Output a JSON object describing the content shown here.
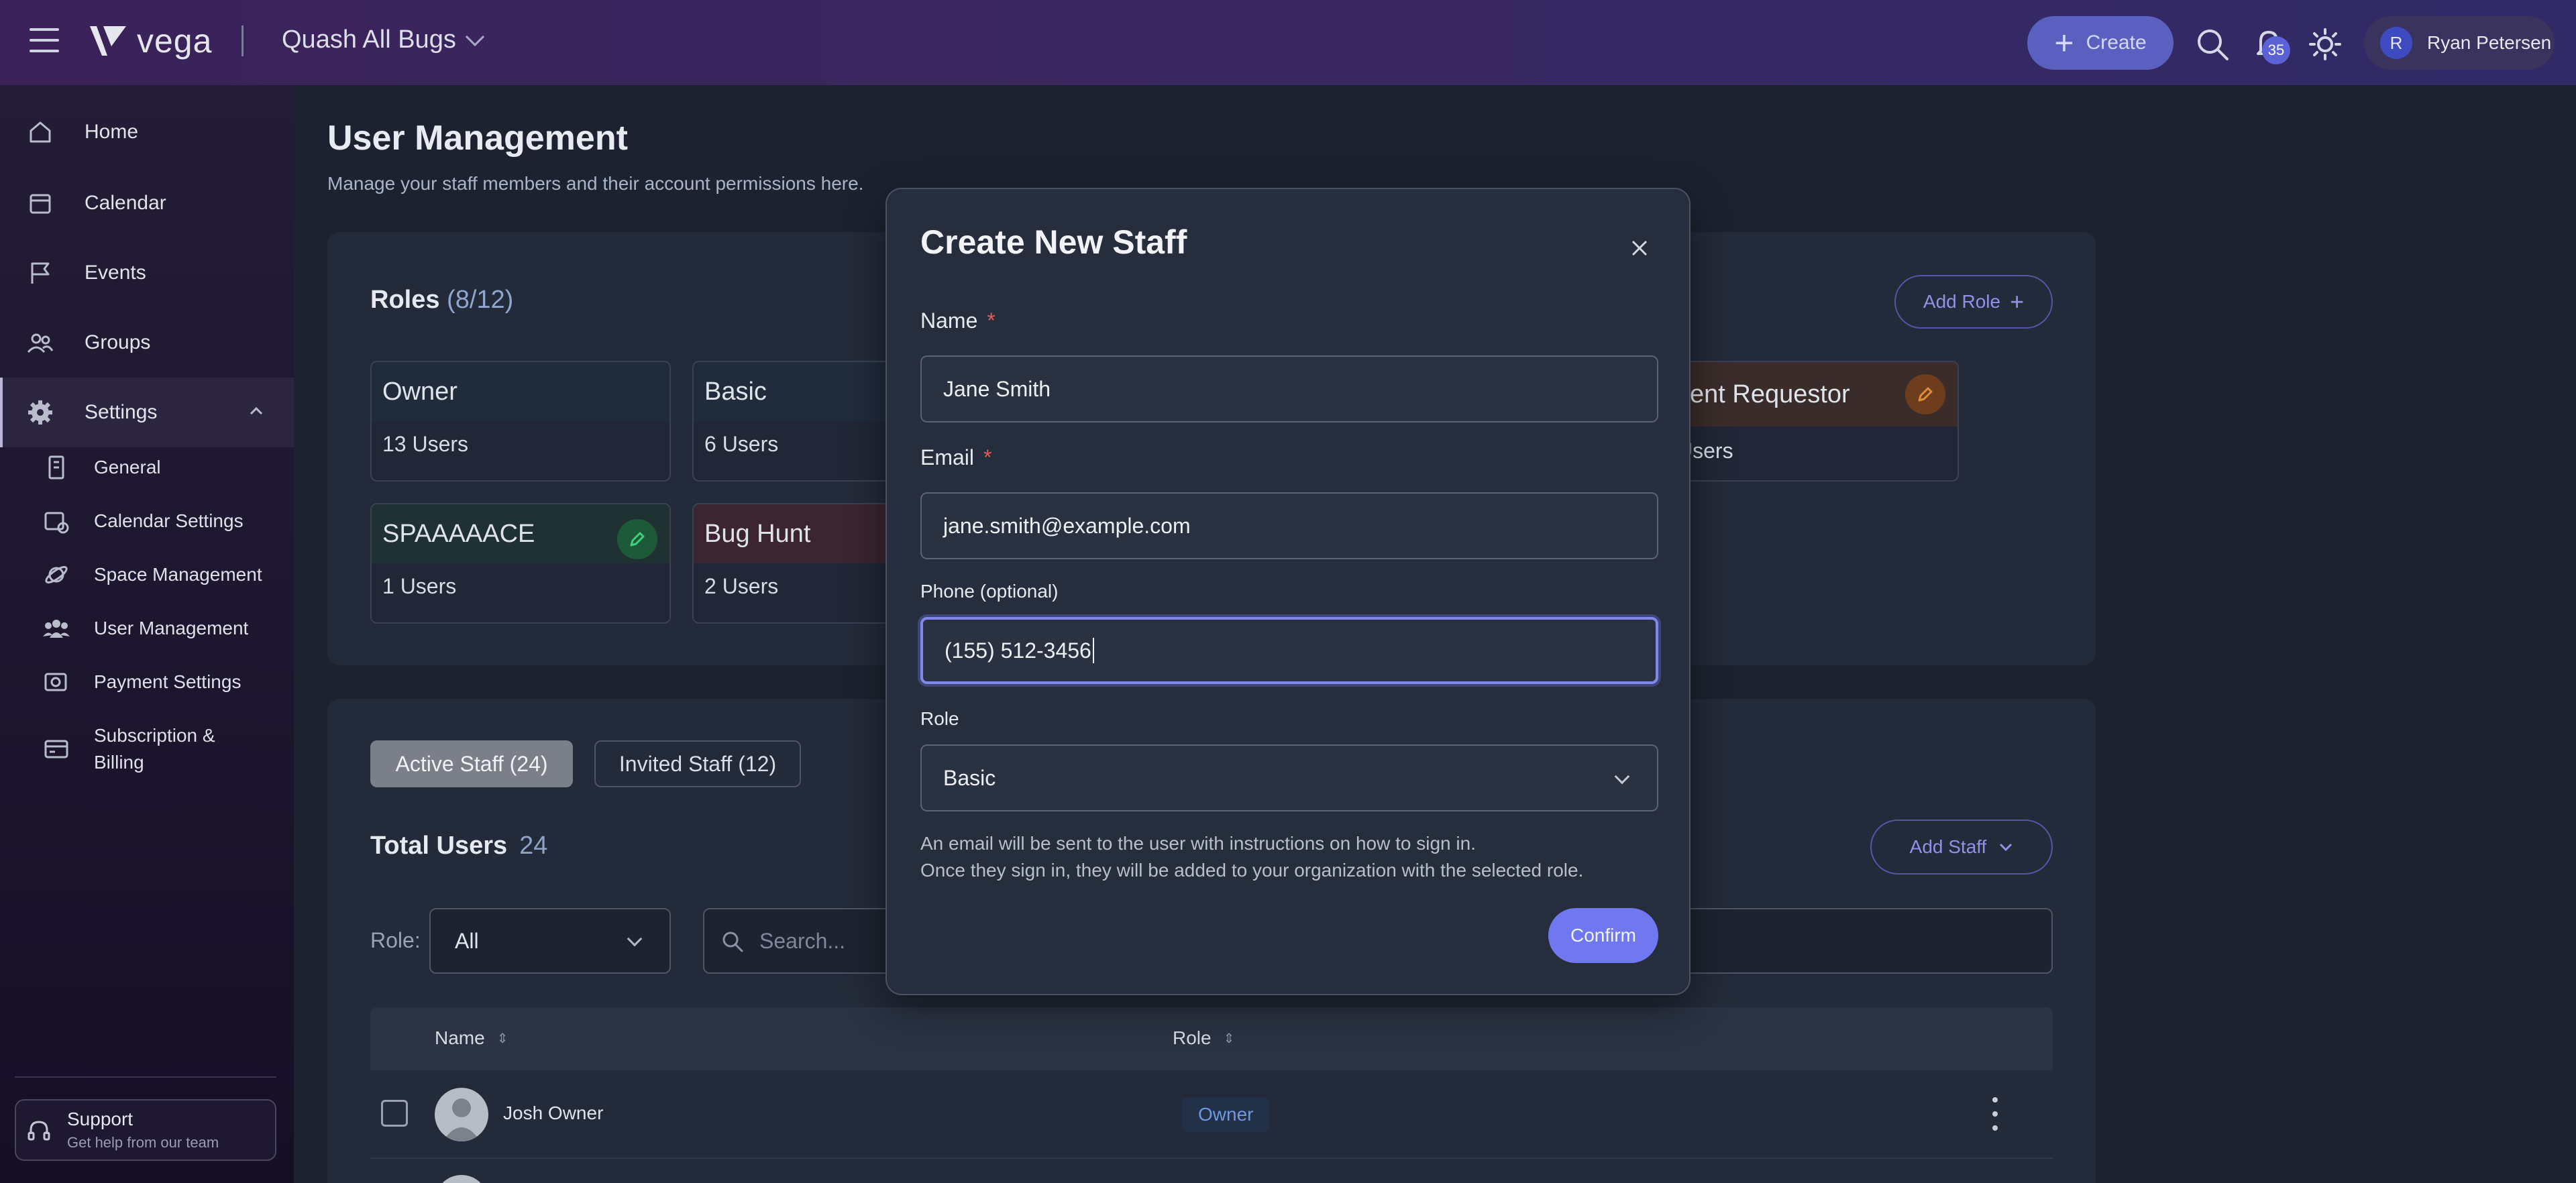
{
  "header": {
    "brand": "vega",
    "org": "Quash All Bugs",
    "create_label": "Create",
    "notif_count": "35",
    "user_initial": "R",
    "user_name": "Ryan Petersen"
  },
  "sidebar": {
    "items": [
      {
        "label": "Home",
        "icon": "home-icon"
      },
      {
        "label": "Calendar",
        "icon": "calendar-icon"
      },
      {
        "label": "Events",
        "icon": "flag-icon"
      },
      {
        "label": "Groups",
        "icon": "groups-icon"
      },
      {
        "label": "Settings",
        "icon": "gear-icon"
      }
    ],
    "sub_items": [
      {
        "label": "General",
        "icon": "building-icon"
      },
      {
        "label": "Calendar Settings",
        "icon": "calendar-settings-icon"
      },
      {
        "label": "Space Management",
        "icon": "planet-icon"
      },
      {
        "label": "User Management",
        "icon": "users-icon"
      },
      {
        "label": "Payment Settings",
        "icon": "payment-icon"
      },
      {
        "label": "Subscription &",
        "label2": "Billing",
        "icon": "card-icon"
      }
    ],
    "support": {
      "title": "Support",
      "subtitle": "Get help from our team"
    }
  },
  "page": {
    "title": "User Management",
    "subtitle": "Manage your staff members and their account permissions here."
  },
  "roles": {
    "title": "Roles",
    "count": "(8/12)",
    "add_label": "Add Role",
    "cards": [
      {
        "name": "Owner",
        "users": "13 Users"
      },
      {
        "name": "Basic",
        "users": "6 Users"
      },
      {
        "name": "vent Requestor",
        "users": "Users"
      },
      {
        "name": "SPAAAAACE",
        "users": "1 Users"
      },
      {
        "name": "Bug Hunt",
        "users": "2 Users"
      }
    ]
  },
  "staff": {
    "tab_active": "Active Staff (24)",
    "tab_invited": "Invited Staff (12)",
    "total_label": "Total Users",
    "total_count": "24",
    "add_label": "Add Staff",
    "role_filter_label": "Role:",
    "role_filter_value": "All",
    "search_placeholder": "Search...",
    "columns": [
      "Name",
      "Role"
    ],
    "rows": [
      {
        "name": "Josh Owner",
        "role": "Owner"
      }
    ]
  },
  "modal": {
    "title": "Create New Staff",
    "name_label": "Name",
    "name_value": "Jane Smith",
    "email_label": "Email",
    "email_value": "jane.smith@example.com",
    "phone_label": "Phone (optional)",
    "phone_value": "(155) 512-3456",
    "role_label": "Role",
    "role_value": "Basic",
    "note_line1": "An email will be sent to the user with instructions on how to sign in.",
    "note_line2": "Once they sign in, they will be added to your organization with the selected role.",
    "confirm_label": "Confirm",
    "required_mark": "*"
  },
  "colors": {
    "accent": "#6f78ee",
    "sidebar_bg": "#1a1329",
    "topbar_bg": "#3a2760",
    "panel_bg": "#232a39",
    "required": "#e35a5a"
  }
}
